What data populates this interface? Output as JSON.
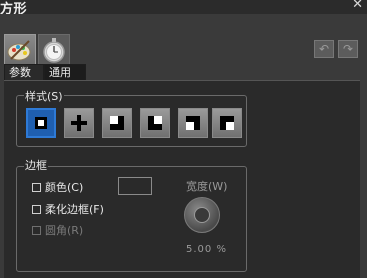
{
  "window": {
    "title": "方形"
  },
  "toolbar": {
    "tool1_icon": "paint-palette-icon",
    "tool2_icon": "stopwatch-icon",
    "undo_icon": "undo-icon",
    "redo_icon": "redo-icon"
  },
  "tabs": [
    {
      "label": "参数"
    },
    {
      "label": "通用"
    }
  ],
  "style_group": {
    "label": "样式(S)",
    "options": [
      "square-outline",
      "square-cross",
      "square-corner-bl",
      "square-corner-tl",
      "square-corner-tr",
      "square-corner-br"
    ]
  },
  "border_group": {
    "label": "边框",
    "color_label": "颜色(C)",
    "soften_label": "柔化边框(F)",
    "rounded_label": "圆角(R)",
    "width_label": "宽度(W)",
    "width_value": "5.00 %"
  }
}
